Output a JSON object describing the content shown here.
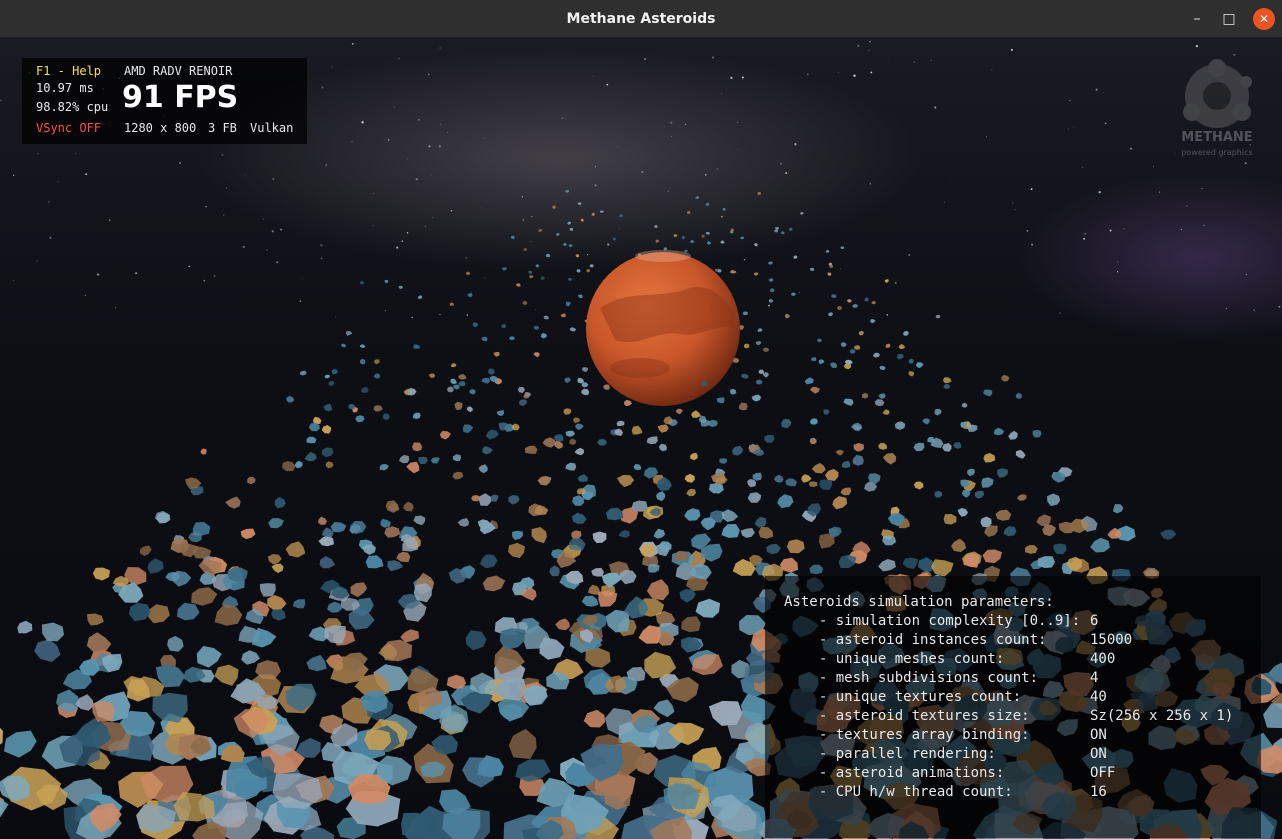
{
  "window": {
    "title": "Methane Asteroids"
  },
  "window_controls": {
    "minimize": "–",
    "maximize": "□",
    "close": "✕"
  },
  "hud": {
    "help": "F1 - Help",
    "frame_time": "10.97 ms",
    "cpu": "98.82% cpu",
    "vsync": "VSync OFF",
    "gpu": "AMD RADV RENOIR",
    "fps": "91 FPS",
    "resolution": "1280 x 800",
    "frame_buffers": "3 FB",
    "api": "Vulkan"
  },
  "logo": {
    "name": "METHANE",
    "tagline": "powered graphics"
  },
  "params": {
    "title": "Asteroids simulation parameters:",
    "items": [
      {
        "label": "  - simulation complexity [0..9]:",
        "value": "6"
      },
      {
        "label": "  - asteroid instances count:",
        "value": "15000"
      },
      {
        "label": "  - unique meshes count:",
        "value": "400"
      },
      {
        "label": "  - mesh subdivisions count:",
        "value": "4"
      },
      {
        "label": "  - unique textures count:",
        "value": "40"
      },
      {
        "label": "  - asteroid textures size:",
        "value": "Sz(256 x 256 x 1)"
      },
      {
        "label": "  - textures array binding:",
        "value": "ON"
      },
      {
        "label": "  - parallel rendering:",
        "value": "ON"
      },
      {
        "label": "  - asteroid animations:",
        "value": "OFF"
      },
      {
        "label": "  - CPU h/w thread count:",
        "value": "16"
      }
    ]
  },
  "colors": {
    "hud_help": "#f2e34a",
    "hud_vsync": "#ff4b4b",
    "planet": "#c8562a",
    "close_button": "#e95420"
  }
}
